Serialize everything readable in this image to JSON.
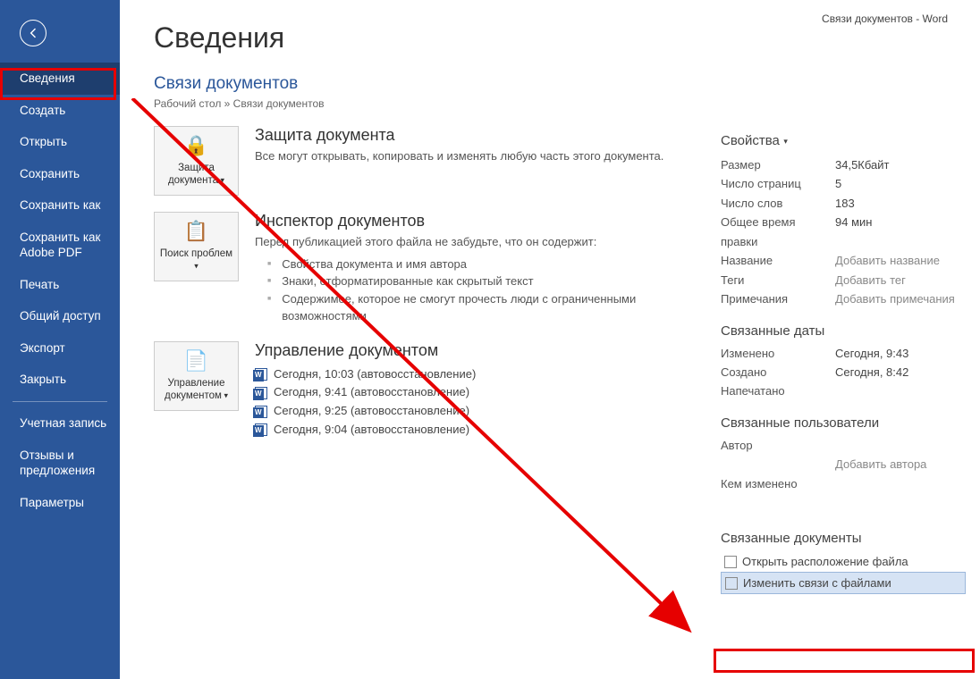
{
  "titleBar": "Связи документов  -  Word",
  "sidebar": {
    "items": [
      "Сведения",
      "Создать",
      "Открыть",
      "Сохранить",
      "Сохранить как",
      "Сохранить как Adobe PDF",
      "Печать",
      "Общий доступ",
      "Экспорт",
      "Закрыть"
    ],
    "secondary": [
      "Учетная запись",
      "Отзывы и предложения",
      "Параметры"
    ],
    "activeIndex": 0
  },
  "page": {
    "title": "Сведения",
    "docTitle": "Связи документов",
    "breadcrumb": "Рабочий стол » Связи документов"
  },
  "protect": {
    "btn": "Защита документа",
    "heading": "Защита документа",
    "text": "Все могут открывать, копировать и изменять любую часть этого документа."
  },
  "inspect": {
    "btn": "Поиск проблем",
    "heading": "Инспектор документов",
    "text": "Перед публикацией этого файла не забудьте, что он содержит:",
    "bullets": [
      "Свойства документа и имя автора",
      "Знаки, отформатированные как скрытый текст",
      "Содержимое, которое не смогут прочесть люди с ограниченными возможностями"
    ]
  },
  "manage": {
    "btn": "Управление документом",
    "heading": "Управление документом",
    "versions": [
      "Сегодня, 10:03 (автовосстановление)",
      "Сегодня, 9:41 (автовосстановление)",
      "Сегодня, 9:25 (автовосстановление)",
      "Сегодня, 9:04 (автовосстановление)"
    ]
  },
  "props": {
    "heading": "Свойства",
    "rows": [
      {
        "k": "Размер",
        "v": "34,5Кбайт"
      },
      {
        "k": "Число страниц",
        "v": "5"
      },
      {
        "k": "Число слов",
        "v": "183"
      },
      {
        "k": "Общее время правки",
        "v": "94 мин"
      },
      {
        "k": "Название",
        "v": "Добавить название",
        "ph": true
      },
      {
        "k": "Теги",
        "v": "Добавить тег",
        "ph": true
      },
      {
        "k": "Примечания",
        "v": "Добавить примечания",
        "ph": true
      }
    ]
  },
  "dates": {
    "heading": "Связанные даты",
    "rows": [
      {
        "k": "Изменено",
        "v": "Сегодня, 9:43"
      },
      {
        "k": "Создано",
        "v": "Сегодня, 8:42"
      },
      {
        "k": "Напечатано",
        "v": ""
      }
    ]
  },
  "users": {
    "heading": "Связанные пользователи",
    "authorLabel": "Автор",
    "addAuthor": "Добавить автора",
    "changedByLabel": "Кем изменено"
  },
  "related": {
    "heading": "Связанные документы",
    "openLoc": "Открыть расположение файла",
    "editLinks": "Изменить связи с файлами"
  }
}
